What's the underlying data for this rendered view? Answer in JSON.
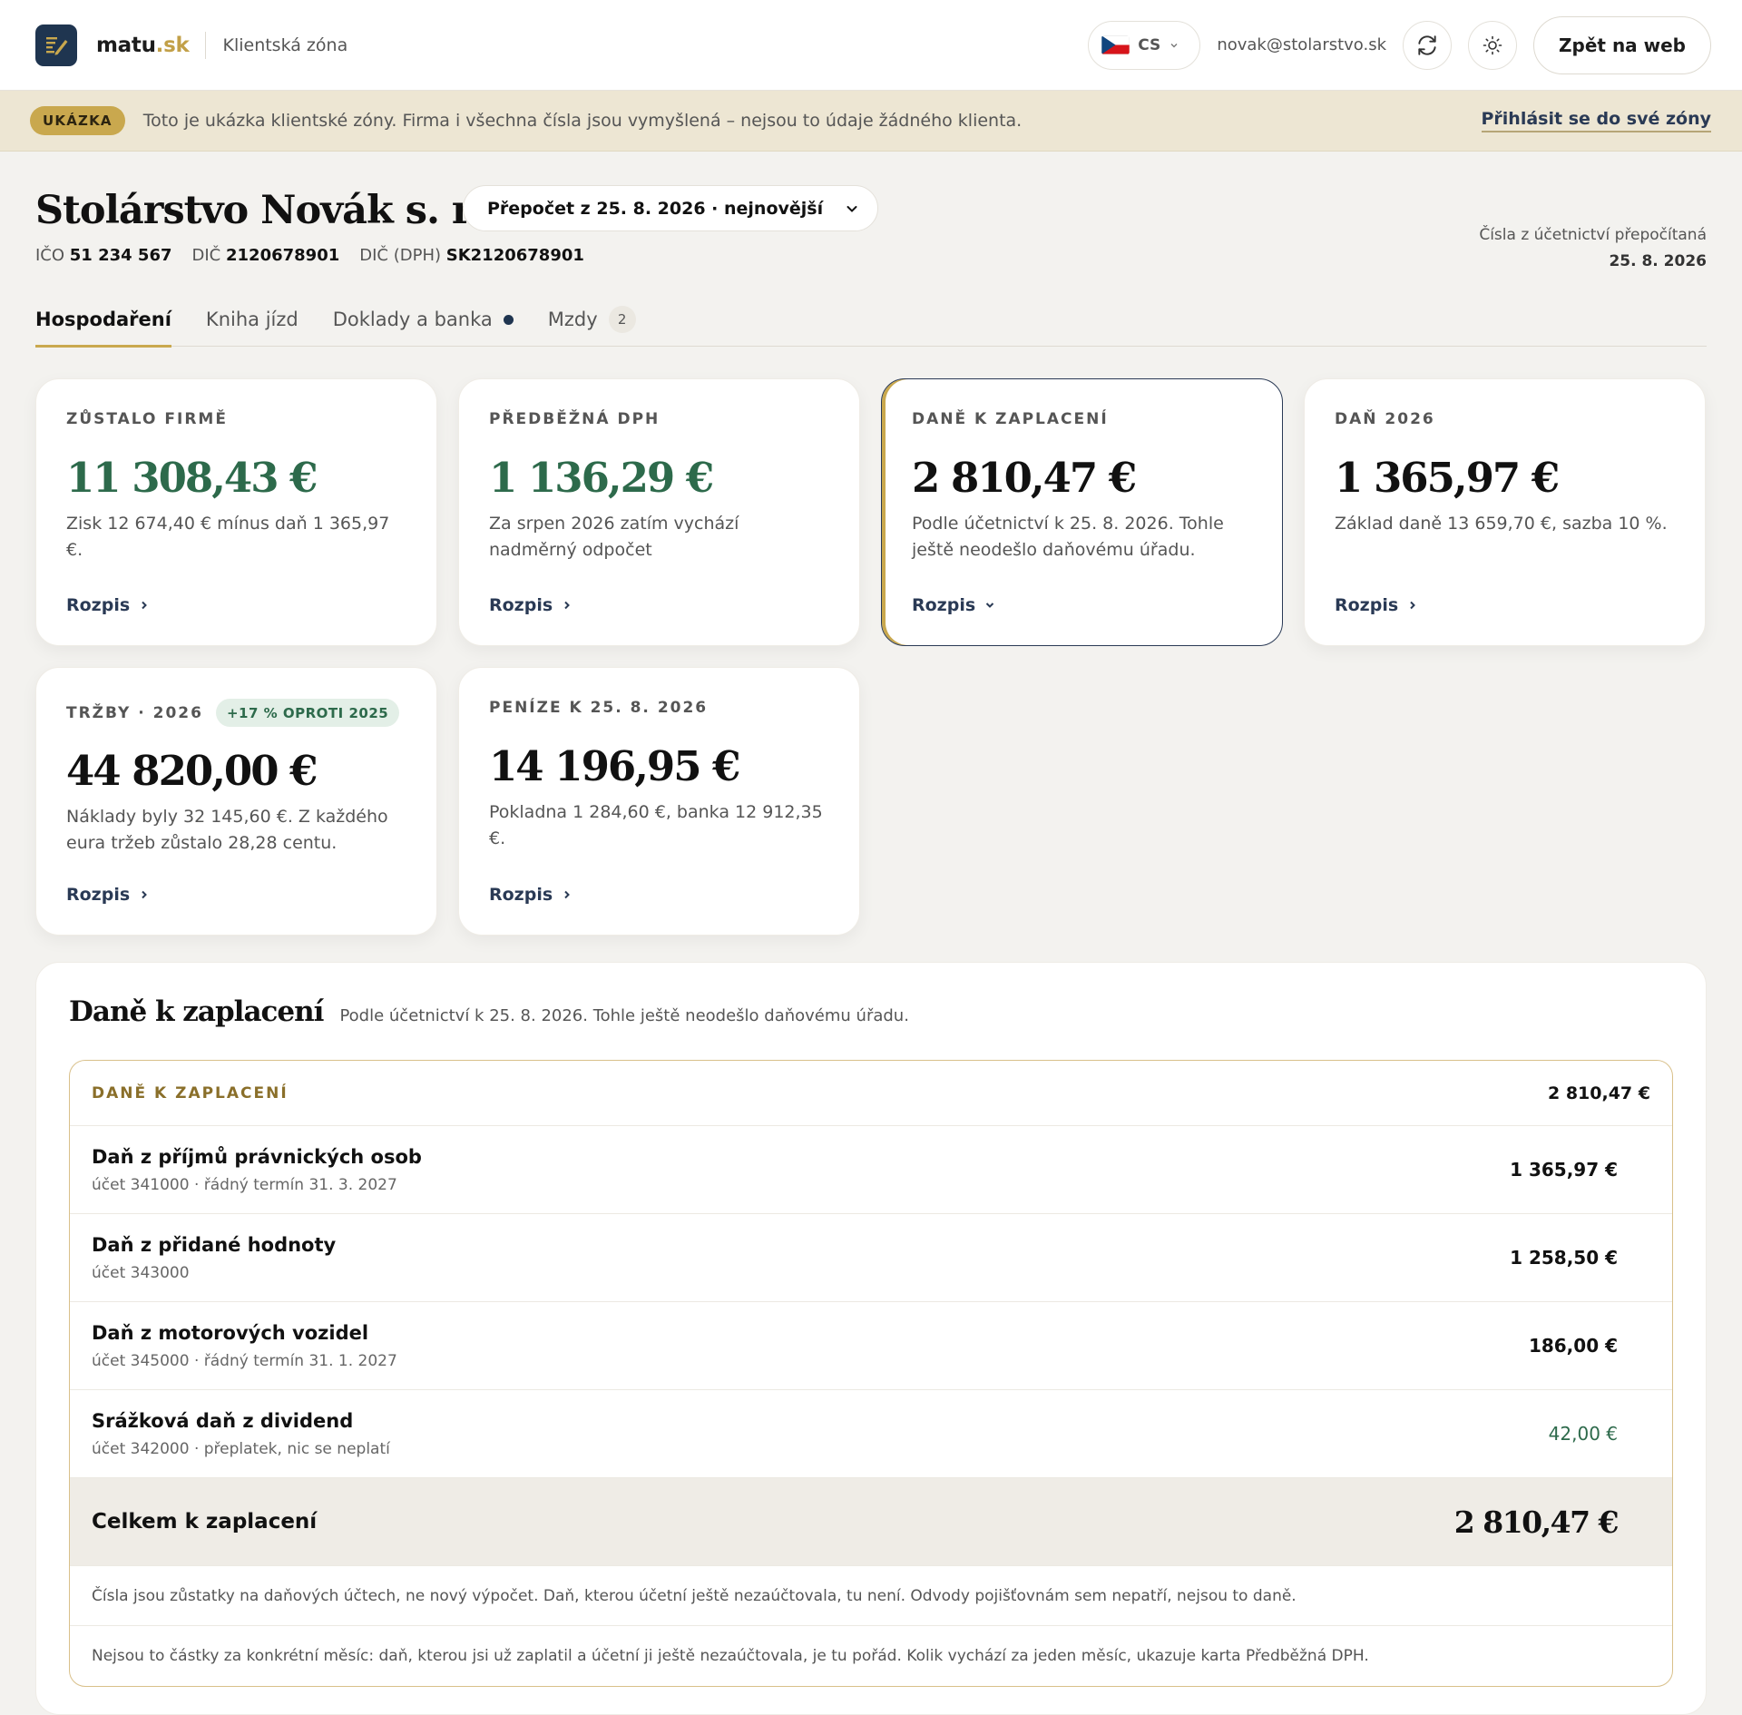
{
  "header": {
    "brand_main": "matu",
    "brand_suffix": ".sk",
    "zone_label": "Klientská zóna",
    "language": "CS",
    "email": "novak@stolarstvo.sk",
    "back_button": "Zpět na web"
  },
  "banner": {
    "badge": "UKÁZKA",
    "text": "Toto je ukázka klientské zóny. Firma i všechna čísla jsou vymyšlená – nejsou to údaje žádného klienta.",
    "login_link": "Přihlásit se do své zóny"
  },
  "company": {
    "name": "Stolárstvo Novák s. r. o.",
    "recalc_select": "Přepočet z 25. 8. 2026 · nejnovější",
    "ico_label": "IČO",
    "ico": "51 234 567",
    "dic_label": "DIČ",
    "dic": "2120678901",
    "icdph_label": "DIČ (DPH)",
    "icdph": "SK2120678901",
    "recalc_info_label": "Čísla z účetnictví přepočítaná",
    "recalc_info_date": "25. 8. 2026"
  },
  "tabs": [
    {
      "label": "Hospodaření",
      "active": true
    },
    {
      "label": "Kniha jízd"
    },
    {
      "label": "Doklady a banka",
      "dot": true
    },
    {
      "label": "Mzdy",
      "count": "2"
    }
  ],
  "cards": [
    {
      "label": "ZŮSTALO FIRMĚ",
      "value": "11 308,43 €",
      "desc": "Zisk 12 674,40 € mínus daň 1 365,97 €.",
      "link": "Rozpis"
    },
    {
      "label": "PŘEDBĚŽNÁ DPH",
      "value": "1 136,29 €",
      "desc": "Za srpen 2026 zatím vychází nadměrný odpočet",
      "link": "Rozpis"
    },
    {
      "label": "DANĚ K ZAPLACENÍ",
      "value": "2 810,47 €",
      "desc": "Podle účetnictví k 25. 8. 2026. Tohle ještě neodešlo daňovému úřadu.",
      "link": "Rozpis"
    },
    {
      "label": "DAŇ 2026",
      "value": "1 365,97 €",
      "desc": "Základ daně 13 659,70 €, sazba 10 %.",
      "link": "Rozpis"
    },
    {
      "label": "TRŽBY · 2026",
      "pill": "+17 % OPROTI 2025",
      "value": "44 820,00 €",
      "desc": "Náklady byly 32 145,60 €. Z každého eura tržeb zůstalo 28,28 centu.",
      "link": "Rozpis"
    },
    {
      "label": "PENÍZE K 25. 8. 2026",
      "value": "14 196,95 €",
      "desc": "Pokladna 1 284,60 €, banka 12 912,35 €.",
      "link": "Rozpis"
    }
  ],
  "taxes": {
    "title": "Daně k zaplacení",
    "subtitle": "Podle účetnictví k 25. 8. 2026. Tohle ještě neodešlo daňovému úřadu.",
    "table_label": "DANĚ K ZAPLACENÍ",
    "table_sum": "2 810,47 €",
    "rows": [
      {
        "name": "Daň z příjmů právnických osob",
        "meta": "účet 341000 · řádný termín 31. 3. 2027",
        "amount": "1 365,97 €"
      },
      {
        "name": "Daň z přidané hodnoty",
        "meta": "účet 343000",
        "amount": "1 258,50 €"
      },
      {
        "name": "Daň z motorových vozidel",
        "meta": "účet 345000 · řádný termín 31. 1. 2027",
        "amount": "186,00 €"
      },
      {
        "name": "Srážková daň z dividend",
        "meta": "účet 342000 · přeplatek, nic se neplatí",
        "amount": "42,00 €"
      }
    ],
    "total_label": "Celkem k zaplacení",
    "total_amount": "2 810,47 €",
    "notes": [
      "Čísla jsou zůstatky na daňových účtech, ne nový výpočet. Daň, kterou účetní ještě nezaúčtovala, tu není. Odvody pojišťovnám sem nepatří, nejsou to daně.",
      "Nejsou to částky za konkrétní měsíc: daň, kterou jsi už zaplatil a účetní ji ještě nezaúčtovala, je tu pořád. Kolik vychází za jeden měsíc, ukazuje karta Předběžná DPH."
    ]
  },
  "colors": {
    "accent_gold": "#c9a84e",
    "navy": "#1f3550",
    "positive_green": "#2d6a4b"
  }
}
